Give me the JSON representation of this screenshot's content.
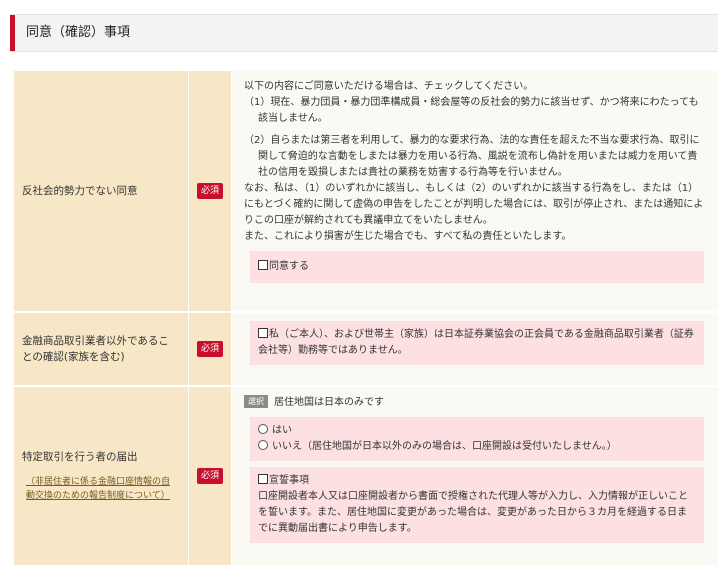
{
  "section_title": "同意（確認）事項",
  "required_label": "必須",
  "rows": [
    {
      "label": "反社会的勢力でない同意",
      "intro": "以下の内容にご同意いただける場合は、チェックしてください。",
      "item1": "（1）現在、暴力団員・暴力団準構成員・総会屋等の反社会的勢力に該当せず、かつ将来にわたっても該当しません。",
      "item2": "（2）自らまたは第三者を利用して、暴力的な要求行為、法的な責任を超えた不当な要求行為、取引に関して脅迫的な言動をしまたは暴力を用いる行為、風説を流布し偽計を用いまたは威力を用いて貴社の信用を毀損しまたは貴社の業務を妨害する行為等を行いません。",
      "note1": "なお、私は、（1）のいずれかに該当し、もしくは（2）のいずれかに該当する行為をし、または（1）にもとづく確約に関して虚偽の申告をしたことが判明した場合には、取引が停止され、または通知によりこの口座が解約されても異議申立てをいたしません。",
      "note2": "また、これにより損害が生じた場合でも、すべて私の責任といたします。",
      "checkbox_label": "同意する"
    },
    {
      "label": "金融商品取引業者以外であることの確認(家族を含む)",
      "checkbox_label": "私（ご本人）、および世帯主（家族）は日本証券業協会の正会員である金融商品取引業者（証券会社等）勤務等ではありません。"
    },
    {
      "label": "特定取引を行う者の届出",
      "link": "（非居住者に係る金融口座情報の自動交換のための報告制度について）",
      "select_badge": "選択",
      "select_title": "居住地国は日本のみです",
      "options": [
        "はい",
        "いいえ（居住地国が日本以外のみの場合は、口座開設は受付いたしません。）"
      ],
      "oath_title": "宣誓事項",
      "oath_text": "口座開設者本人又は口座開設者から書面で授権された代理人等が入力し、入力情報が正しいことを誓います。また、居住地国に変更があった場合は、変更があった日から３カ月を経過する日までに異動届出書により申告します。"
    }
  ]
}
